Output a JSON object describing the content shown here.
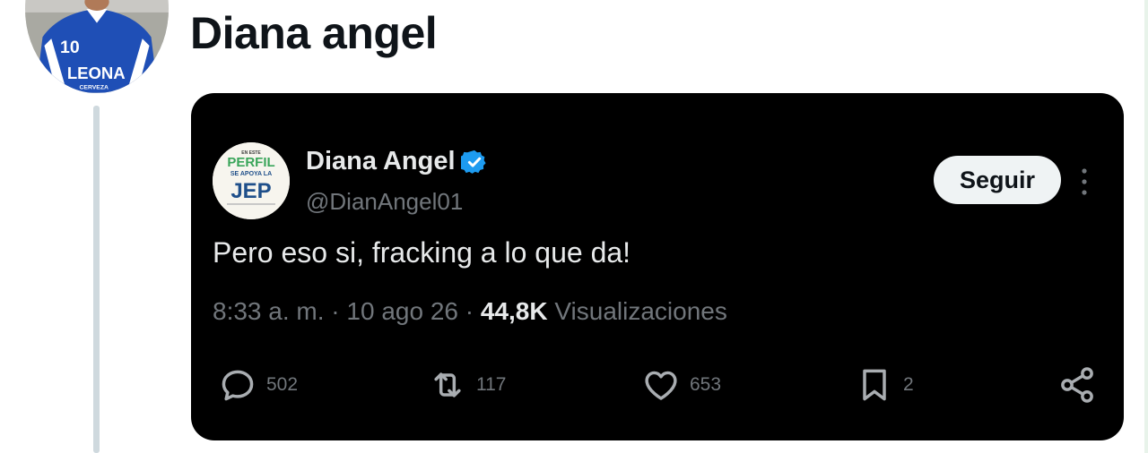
{
  "post": {
    "author_name": "Diana angel"
  },
  "embedded_tweet": {
    "avatar_text": {
      "small": "EN ESTE",
      "line1": "PERFIL",
      "line2": "SE APOYA LA",
      "line3": "JEP"
    },
    "display_name": "Diana Angel",
    "handle": "@DianAngel01",
    "follow_label": "Seguir",
    "text": "Pero eso si, fracking a lo que da!",
    "time": "8:33 a. m.",
    "separator": " · ",
    "date": "10 ago 26",
    "views_count": "44,8K",
    "views_label": " Visualizaciones",
    "actions": {
      "replies": "502",
      "retweets": "117",
      "likes": "653",
      "bookmarks": "2"
    }
  },
  "profile_avatar_text": {
    "number": "10",
    "sponsor": "LEONA",
    "sponsor_sub": "CERVEZA"
  },
  "colors": {
    "card_bg": "#000000",
    "verified": "#1d9bf0",
    "muted": "#71767b",
    "text_light": "#e7e9ea",
    "thread_line": "#cfd9de"
  },
  "icons": [
    "verified-badge-icon",
    "more-options-icon",
    "reply-icon",
    "retweet-icon",
    "like-icon",
    "bookmark-icon",
    "share-icon"
  ]
}
